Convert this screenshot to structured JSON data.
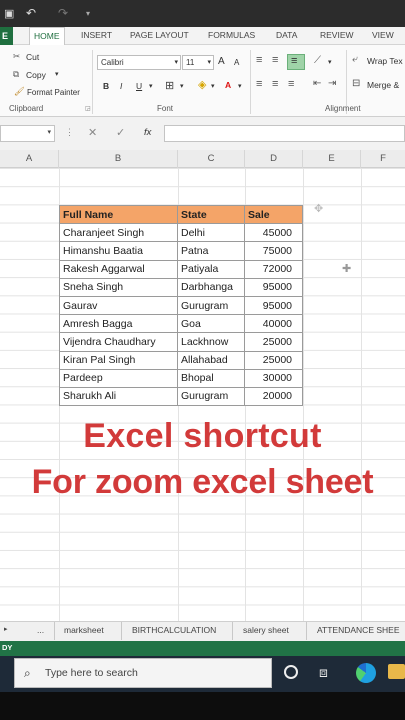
{
  "ribbon": {
    "file_tab": "E",
    "tabs": [
      "HOME",
      "INSERT",
      "PAGE LAYOUT",
      "FORMULAS",
      "DATA",
      "REVIEW",
      "VIEW"
    ],
    "clipboard": {
      "cut": "Cut",
      "copy": "Copy",
      "format_painter": "Format Painter",
      "label": "Clipboard"
    },
    "font": {
      "name": "Calibri",
      "size": "11",
      "bold": "B",
      "italic": "I",
      "underline": "U",
      "grow": "A",
      "shrink": "A",
      "label": "Font"
    },
    "alignment": {
      "wrap": "Wrap Tex",
      "merge": "Merge &",
      "label": "Alignment"
    }
  },
  "formula_bar": {
    "fx": "fx",
    "cancel": "✕",
    "enter": "✓"
  },
  "columns": [
    "A",
    "B",
    "C",
    "D",
    "E",
    "F"
  ],
  "table": {
    "headers": [
      "Full Name",
      "State",
      "Sale"
    ],
    "rows": [
      [
        "Charanjeet Singh",
        "Delhi",
        "45000"
      ],
      [
        "Himanshu Baatia",
        "Patna",
        "75000"
      ],
      [
        "Rakesh Aggarwal",
        "Patiyala",
        "72000"
      ],
      [
        "Sneha Singh",
        "Darbhanga",
        "95000"
      ],
      [
        "Gaurav",
        "Gurugram",
        "95000"
      ],
      [
        "Amresh Bagga",
        "Goa",
        "40000"
      ],
      [
        "Vijendra Chaudhary",
        "Lackhnow",
        "25000"
      ],
      [
        "Kiran Pal Singh",
        "Allahabad",
        "25000"
      ],
      [
        "Pardeep",
        "Bhopal",
        "30000"
      ],
      [
        "Sharukh Ali",
        "Gurugram",
        "20000"
      ]
    ]
  },
  "overlay": {
    "line1": "Excel shortcut",
    "line2": "For zoom excel sheet"
  },
  "sheet_tabs": {
    "nav": "...",
    "tabs": [
      "marksheet",
      "BIRTHCALCULATION",
      "salery sheet",
      "ATTENDANCE SHEE"
    ]
  },
  "status": {
    "text": "DY"
  },
  "taskbar": {
    "search_placeholder": "Type here to search"
  },
  "colors": {
    "header_fill": "#f4a468",
    "overlay_text": "#d23a3a",
    "excel_green": "#217346"
  }
}
